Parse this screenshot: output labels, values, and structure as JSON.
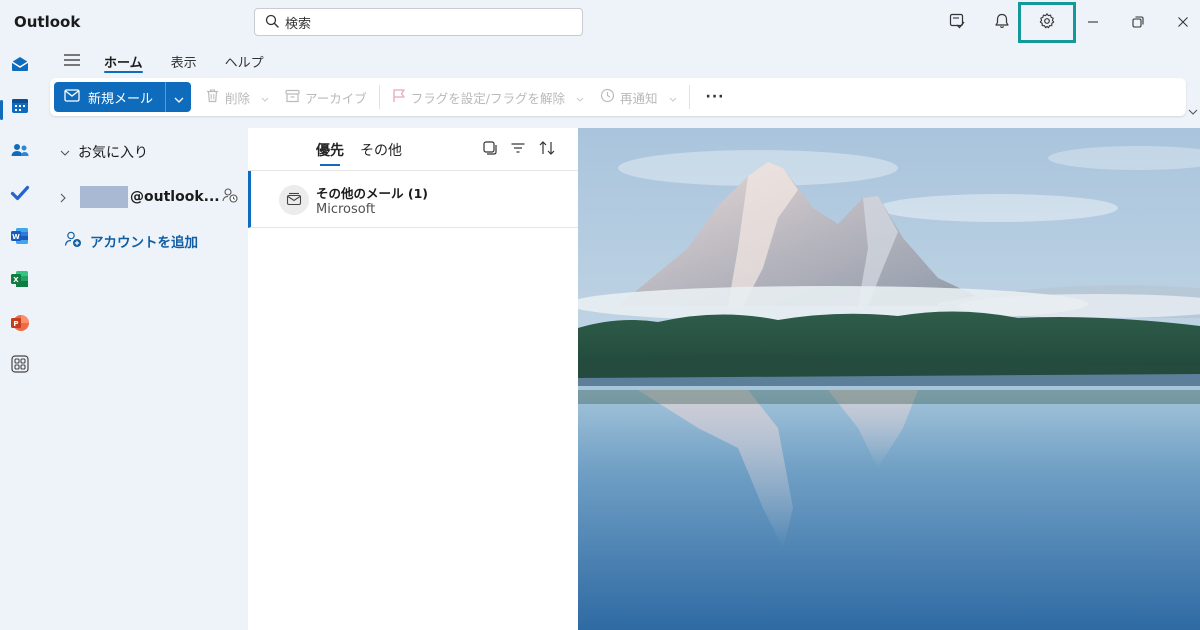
{
  "app": {
    "title": "Outlook"
  },
  "search": {
    "placeholder": "検索"
  },
  "ribbon": {
    "tabs": [
      {
        "label": "ホーム",
        "active": true
      },
      {
        "label": "表示",
        "active": false
      },
      {
        "label": "ヘルプ",
        "active": false
      }
    ],
    "new_mail": "新規メール",
    "delete": "削除",
    "archive": "アーカイブ",
    "flag": "フラグを設定/フラグを解除",
    "snooze": "再通知",
    "more": "···"
  },
  "folders": {
    "favorites": "お気に入り",
    "account_suffix": "@outlook...",
    "add_account": "アカウントを追加"
  },
  "message_list": {
    "tabs": [
      {
        "label": "優先",
        "active": true
      },
      {
        "label": "その他",
        "active": false
      }
    ],
    "items": [
      {
        "title": "その他のメール (1)",
        "sender": "Microsoft"
      }
    ]
  },
  "colors": {
    "accent": "#0f6cbd",
    "highlight": "#14999a"
  }
}
